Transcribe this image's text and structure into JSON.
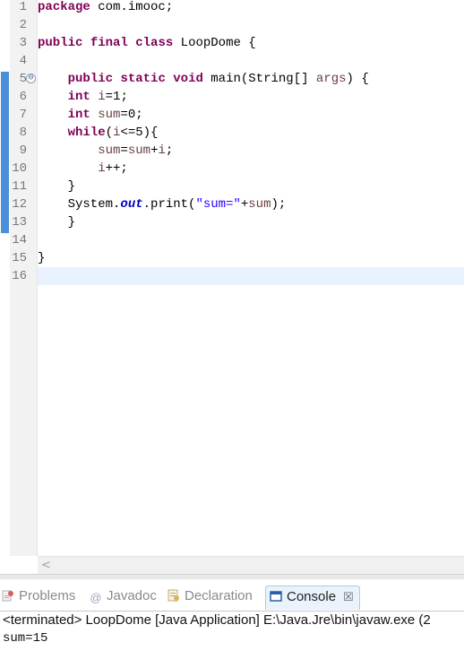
{
  "editor": {
    "lines": [
      {
        "no": "1",
        "tokens": [
          {
            "t": "package",
            "c": "kw"
          },
          {
            "t": " com.imooc;",
            "c": "pl"
          }
        ]
      },
      {
        "no": "2",
        "tokens": []
      },
      {
        "no": "3",
        "tokens": [
          {
            "t": "public",
            "c": "kw"
          },
          {
            "t": " ",
            "c": "pl"
          },
          {
            "t": "final",
            "c": "kw"
          },
          {
            "t": " ",
            "c": "pl"
          },
          {
            "t": "class",
            "c": "kw"
          },
          {
            "t": " LoopDome {",
            "c": "pl"
          }
        ]
      },
      {
        "no": "4",
        "tokens": []
      },
      {
        "no": "5",
        "fold": "⊖",
        "tokens": [
          {
            "t": "    ",
            "c": "pl"
          },
          {
            "t": "public",
            "c": "kw"
          },
          {
            "t": " ",
            "c": "pl"
          },
          {
            "t": "static",
            "c": "kw"
          },
          {
            "t": " ",
            "c": "pl"
          },
          {
            "t": "void",
            "c": "kw"
          },
          {
            "t": " main(String[] ",
            "c": "pl"
          },
          {
            "t": "args",
            "c": "var"
          },
          {
            "t": ") {",
            "c": "pl"
          }
        ]
      },
      {
        "no": "6",
        "tokens": [
          {
            "t": "    ",
            "c": "pl"
          },
          {
            "t": "int",
            "c": "kw"
          },
          {
            "t": " ",
            "c": "pl"
          },
          {
            "t": "i",
            "c": "var"
          },
          {
            "t": "=1;",
            "c": "pl"
          }
        ]
      },
      {
        "no": "7",
        "tokens": [
          {
            "t": "    ",
            "c": "pl"
          },
          {
            "t": "int",
            "c": "kw"
          },
          {
            "t": " ",
            "c": "pl"
          },
          {
            "t": "sum",
            "c": "var"
          },
          {
            "t": "=0;",
            "c": "pl"
          }
        ]
      },
      {
        "no": "8",
        "tokens": [
          {
            "t": "    ",
            "c": "pl"
          },
          {
            "t": "while",
            "c": "kw"
          },
          {
            "t": "(",
            "c": "pl"
          },
          {
            "t": "i",
            "c": "var"
          },
          {
            "t": "<=5){",
            "c": "pl"
          }
        ]
      },
      {
        "no": "9",
        "tokens": [
          {
            "t": "        ",
            "c": "pl"
          },
          {
            "t": "sum",
            "c": "var"
          },
          {
            "t": "=",
            "c": "pl"
          },
          {
            "t": "sum",
            "c": "var"
          },
          {
            "t": "+",
            "c": "pl"
          },
          {
            "t": "i",
            "c": "var"
          },
          {
            "t": ";",
            "c": "pl"
          }
        ]
      },
      {
        "no": "10",
        "tokens": [
          {
            "t": "        ",
            "c": "pl"
          },
          {
            "t": "i",
            "c": "var"
          },
          {
            "t": "++;",
            "c": "pl"
          }
        ]
      },
      {
        "no": "11",
        "tokens": [
          {
            "t": "    }",
            "c": "pl"
          }
        ]
      },
      {
        "no": "12",
        "tokens": [
          {
            "t": "    System.",
            "c": "pl"
          },
          {
            "t": "out",
            "c": "fld"
          },
          {
            "t": ".print(",
            "c": "pl"
          },
          {
            "t": "\"sum=\"",
            "c": "str"
          },
          {
            "t": "+",
            "c": "pl"
          },
          {
            "t": "sum",
            "c": "var"
          },
          {
            "t": ");",
            "c": "pl"
          }
        ]
      },
      {
        "no": "13",
        "tokens": [
          {
            "t": "    }",
            "c": "pl"
          }
        ]
      },
      {
        "no": "14",
        "tokens": []
      },
      {
        "no": "15",
        "tokens": [
          {
            "t": "}",
            "c": "pl"
          }
        ]
      },
      {
        "no": "16",
        "tokens": []
      }
    ],
    "current_line": "16",
    "changed_lines": [
      "5",
      "13"
    ],
    "scroll_left_glyph": "<"
  },
  "panel": {
    "tabs": [
      {
        "label": "Problems",
        "icon": "problems-icon",
        "active": false
      },
      {
        "label": "Javadoc",
        "icon": "javadoc-icon",
        "active": false
      },
      {
        "label": "Declaration",
        "icon": "declaration-icon",
        "active": false
      },
      {
        "label": "Console",
        "icon": "console-icon",
        "active": true,
        "close": "☒"
      }
    ],
    "console": {
      "status": "<terminated> LoopDome [Java Application] E:\\Java.Jre\\bin\\javaw.exe (2",
      "output": "sum=15"
    }
  },
  "colors": {
    "keyword": "#7f0055",
    "variable": "#6a3e3e",
    "string": "#2a00ff",
    "static_field": "#0000c0",
    "change_bar": "#4a90d9",
    "current_line_bg": "#e8f2fe"
  }
}
